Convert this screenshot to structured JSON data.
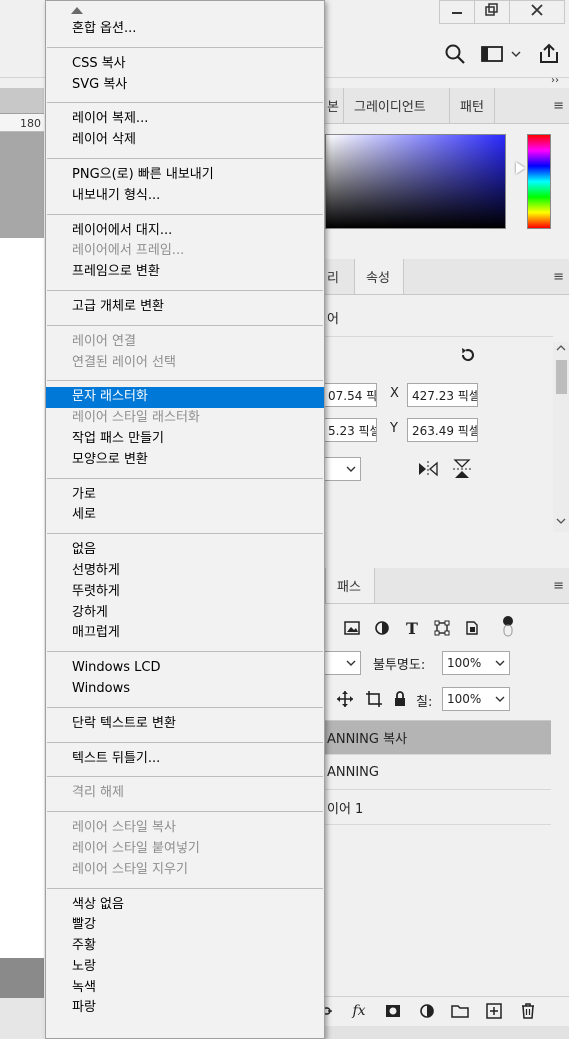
{
  "window": {
    "minimize_icon": "minimize-icon",
    "restore_icon": "restore-icon",
    "close_icon": "close-icon"
  },
  "document": {
    "ruler_value": "180"
  },
  "color_panel": {
    "tabs": [
      "그레이디언트",
      "패턴"
    ],
    "partial_tab": "본"
  },
  "properties_panel": {
    "tabs": [
      "속성"
    ],
    "partial_tab": "리",
    "partial_label": "어",
    "width_value": "07.54 픽'",
    "x_label": "X",
    "x_value": "427.23 픽셀",
    "height_value": "5.23 픽셀",
    "y_label": "Y",
    "y_value": "263.49 픽셀"
  },
  "layers_panel": {
    "tabs": [
      "패스"
    ],
    "opacity_label": "불투명도:",
    "opacity_value": "100%",
    "fill_label": "칠:",
    "fill_value": "100%",
    "layers": [
      "ANNING 복사",
      "ANNING",
      "이어 1"
    ],
    "bottom_fx": "fx"
  },
  "menu": {
    "items": [
      {
        "label": "혼합 옵션...",
        "disabled": false
      },
      {
        "sep": true
      },
      {
        "label": "CSS 복사",
        "disabled": false
      },
      {
        "label": "SVG 복사",
        "disabled": false
      },
      {
        "sep": true
      },
      {
        "label": "레이어 복제...",
        "disabled": false
      },
      {
        "label": "레이어 삭제",
        "disabled": false
      },
      {
        "sep": true
      },
      {
        "label": "PNG으(로) 빠른 내보내기",
        "disabled": false
      },
      {
        "label": "내보내기 형식...",
        "disabled": false
      },
      {
        "sep": true
      },
      {
        "label": "레이어에서 대지...",
        "disabled": false
      },
      {
        "label": "레이어에서 프레임...",
        "disabled": true
      },
      {
        "label": "프레임으로 변환",
        "disabled": false
      },
      {
        "sep": true
      },
      {
        "label": "고급 개체로 변환",
        "disabled": false
      },
      {
        "sep": true
      },
      {
        "label": "레이어 연결",
        "disabled": true
      },
      {
        "label": "연결된 레이어 선택",
        "disabled": true
      },
      {
        "sep": true
      },
      {
        "label": "문자 래스터화",
        "disabled": false,
        "highlighted": true
      },
      {
        "label": "레이어 스타일 래스터화",
        "disabled": true
      },
      {
        "label": "작업 패스 만들기",
        "disabled": false
      },
      {
        "label": "모양으로 변환",
        "disabled": false
      },
      {
        "sep": true
      },
      {
        "label": "가로",
        "disabled": false
      },
      {
        "label": "세로",
        "disabled": false
      },
      {
        "sep": true
      },
      {
        "label": "없음",
        "disabled": false
      },
      {
        "label": "선명하게",
        "disabled": false
      },
      {
        "label": "뚜렷하게",
        "disabled": false
      },
      {
        "label": "강하게",
        "disabled": false
      },
      {
        "label": "매끄럽게",
        "disabled": false
      },
      {
        "sep": true
      },
      {
        "label": "Windows LCD",
        "disabled": false
      },
      {
        "label": "Windows",
        "disabled": false
      },
      {
        "sep": true
      },
      {
        "label": "단락 텍스트로 변환",
        "disabled": false
      },
      {
        "sep": true
      },
      {
        "label": "텍스트 뒤틀기...",
        "disabled": false
      },
      {
        "sep": true
      },
      {
        "label": "격리 해제",
        "disabled": true
      },
      {
        "sep": true
      },
      {
        "label": "레이어 스타일 복사",
        "disabled": true
      },
      {
        "label": "레이어 스타일 붙여넣기",
        "disabled": true
      },
      {
        "label": "레이어 스타일 지우기",
        "disabled": true
      },
      {
        "sep": true
      },
      {
        "label": "색상 없음",
        "disabled": false
      },
      {
        "label": "빨강",
        "disabled": false
      },
      {
        "label": "주황",
        "disabled": false
      },
      {
        "label": "노랑",
        "disabled": false
      },
      {
        "label": "녹색",
        "disabled": false
      },
      {
        "label": "파랑",
        "disabled": false
      }
    ]
  },
  "colors": {
    "highlight": "#0078d7",
    "menu_bg": "#f2f2f2",
    "disabled_text": "#8e8e8e"
  }
}
